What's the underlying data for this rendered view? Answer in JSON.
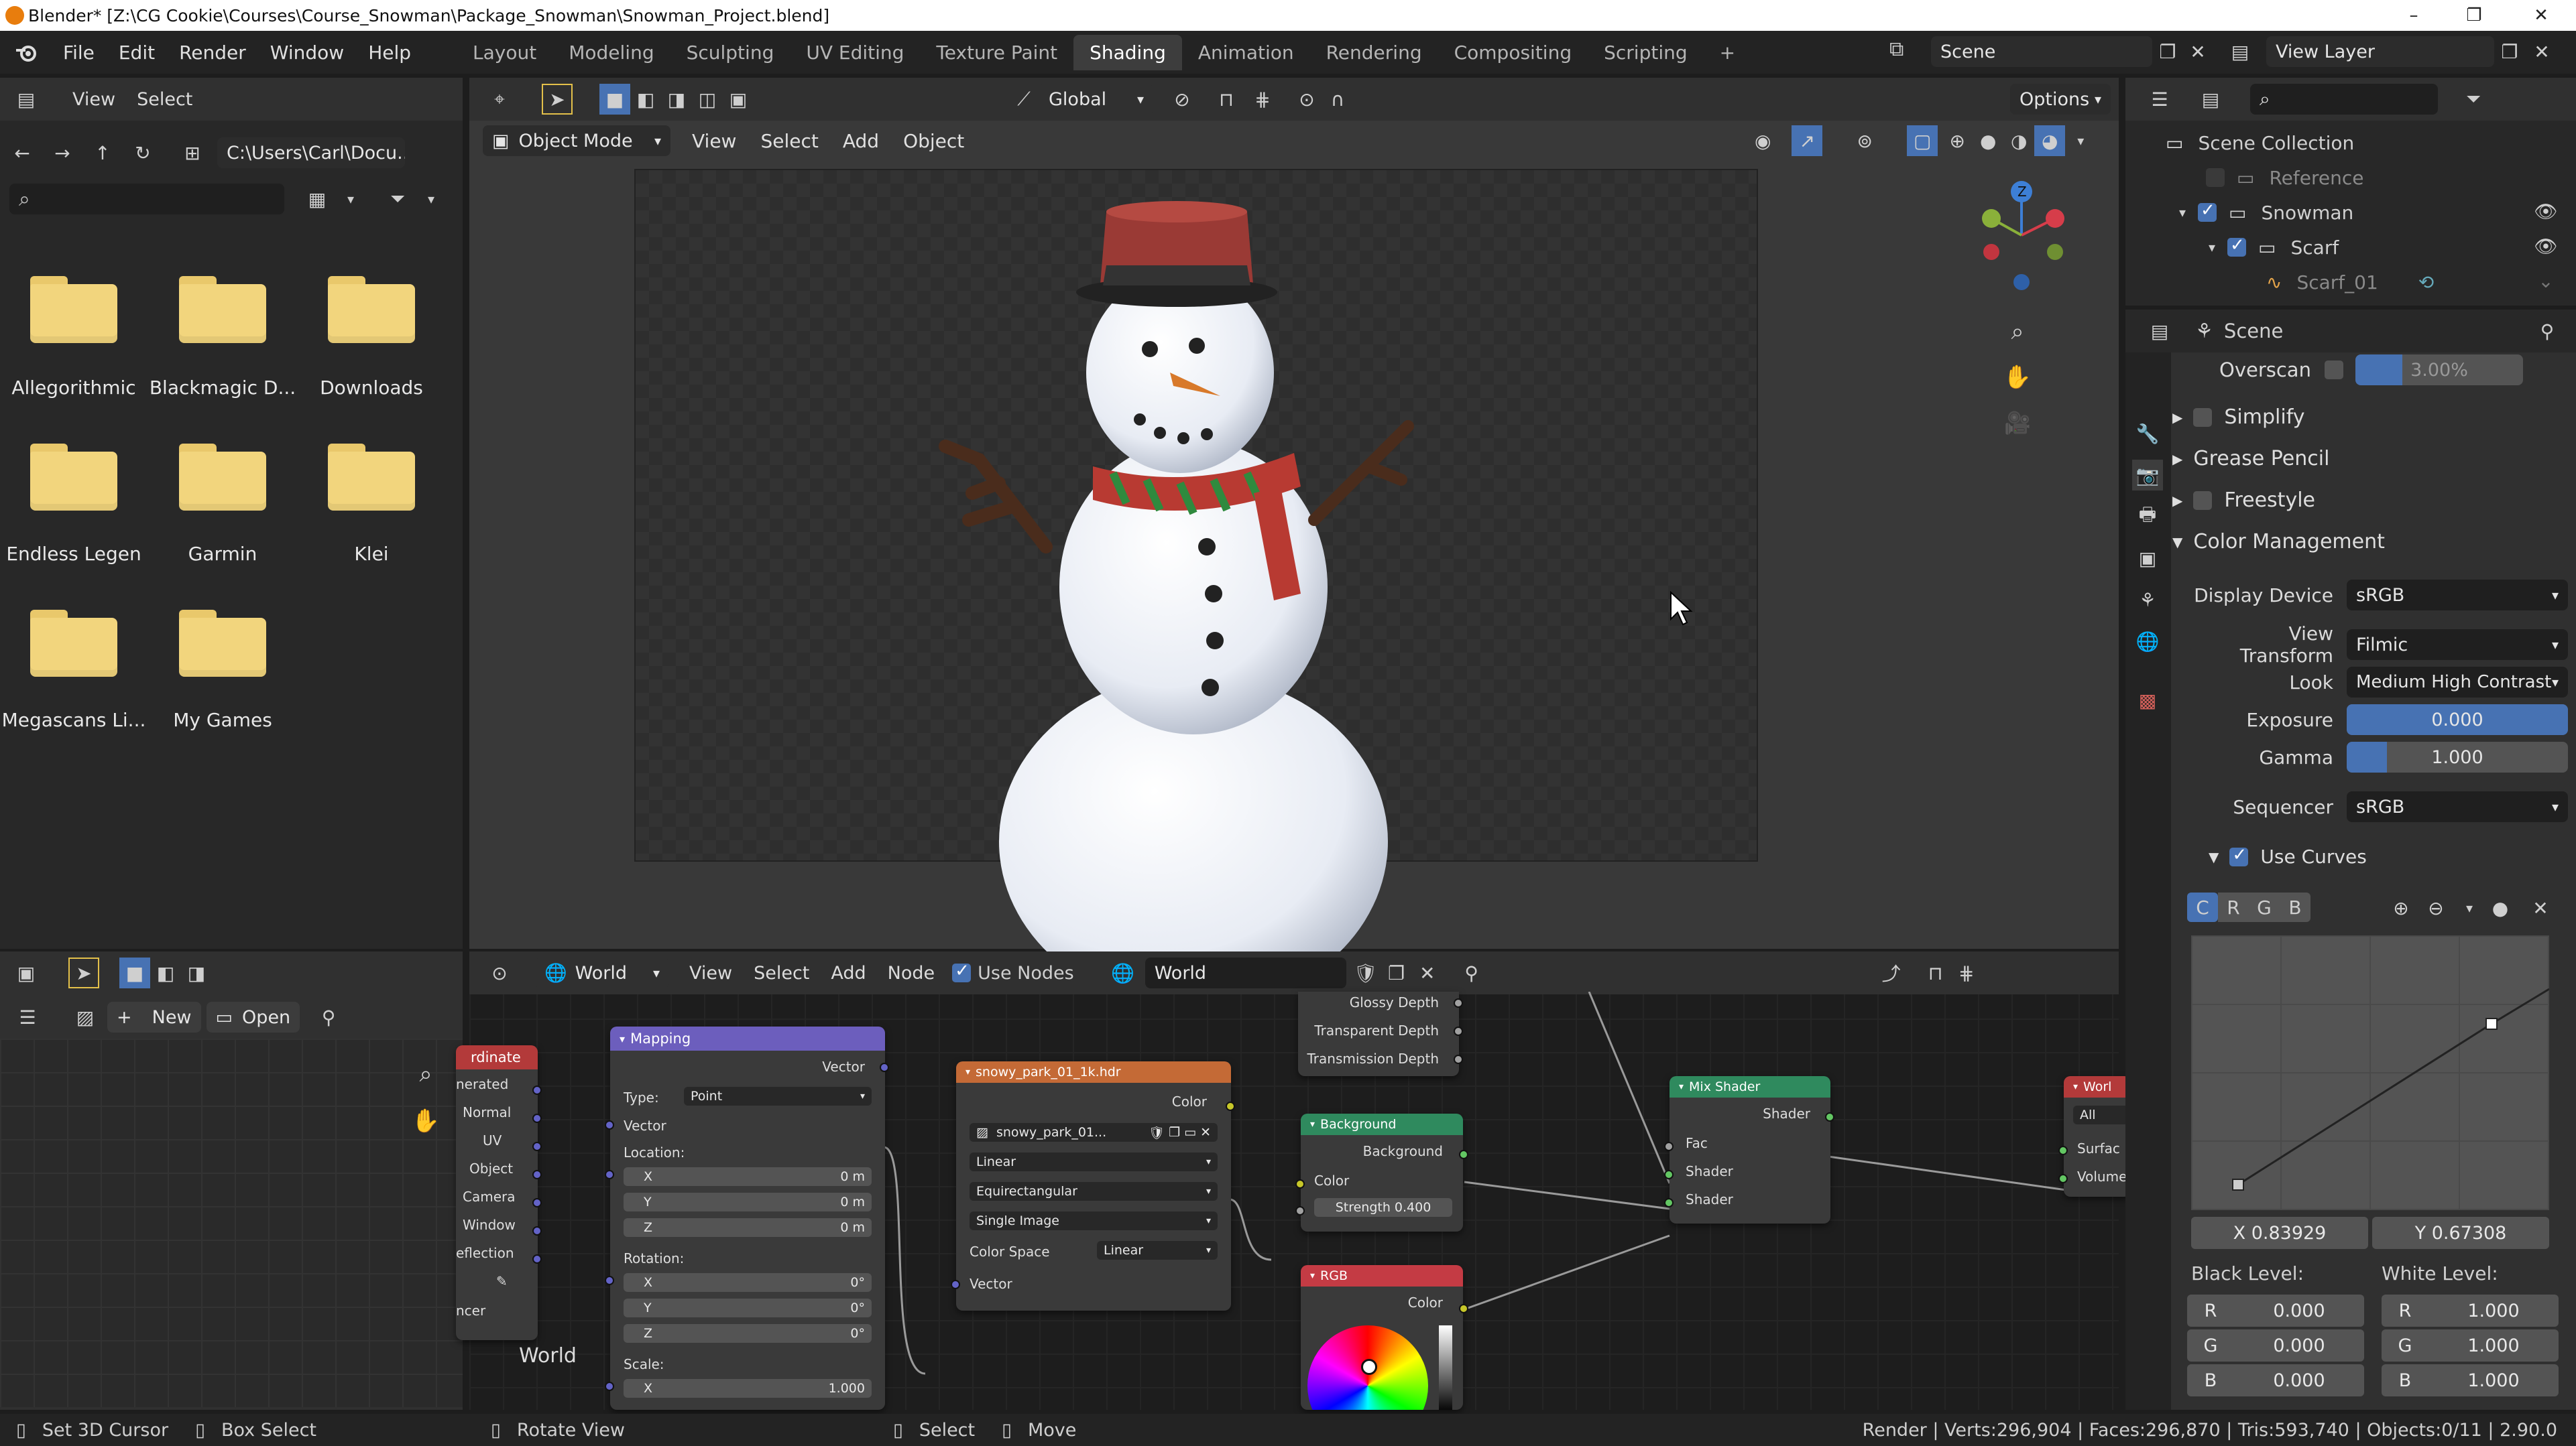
{
  "title_bar": {
    "title": "Blender* [Z:\\CG Cookie\\Courses\\Course_Snowman\\Package_Snowman\\Snowman_Project.blend]"
  },
  "menu": [
    "File",
    "Edit",
    "Render",
    "Window",
    "Help"
  ],
  "workspace_tabs": [
    "Layout",
    "Modeling",
    "Sculpting",
    "UV Editing",
    "Texture Paint",
    "Shading",
    "Animation",
    "Rendering",
    "Compositing",
    "Scripting"
  ],
  "active_tab": "Shading",
  "scene_selector": "Scene",
  "view_layer_selector": "View Layer",
  "file_browser": {
    "header": {
      "view": "View",
      "select": "Select"
    },
    "path": "C:\\Users\\Carl\\Docu...",
    "folders": [
      "Allegorithmic",
      "Blackmagic D...",
      "Downloads",
      "Endless Legen",
      "Garmin",
      "Klei",
      "Megascans Li...",
      "My Games"
    ]
  },
  "image_editor": {
    "new_label": "New",
    "open_label": "Open"
  },
  "viewport": {
    "transform_orientation": "Global",
    "options_label": "Options",
    "mode": "Object Mode",
    "menus": [
      "View",
      "Select",
      "Add",
      "Object"
    ]
  },
  "node_editor": {
    "world_type": "World",
    "menus": [
      "View",
      "Select",
      "Add",
      "Node"
    ],
    "use_nodes_label": "Use Nodes",
    "world_name": "World",
    "frame_label": "World",
    "texcoord": {
      "title": "rdinate",
      "outputs": [
        "nerated",
        "Normal",
        "UV",
        "Object",
        "Camera",
        "Window",
        "eflection"
      ],
      "footer": "ncer"
    },
    "mapping": {
      "title": "Mapping",
      "vector_out": "Vector",
      "type_label": "Type:",
      "type_value": "Point",
      "vector_in": "Vector",
      "location_label": "Location:",
      "loc": [
        {
          "axis": "X",
          "value": "0 m"
        },
        {
          "axis": "Y",
          "value": "0 m"
        },
        {
          "axis": "Z",
          "value": "0 m"
        }
      ],
      "rotation_label": "Rotation:",
      "rot": [
        {
          "axis": "X",
          "value": "0°"
        },
        {
          "axis": "Y",
          "value": "0°"
        },
        {
          "axis": "Z",
          "value": "0°"
        }
      ],
      "scale_label": "Scale:",
      "scale_x": {
        "axis": "X",
        "value": "1.000"
      }
    },
    "env_texture": {
      "title": "snowy_park_01_1k.hdr",
      "color_out": "Color",
      "image_name": "snowy_park_01...",
      "interpolation": "Linear",
      "projection": "Equirectangular",
      "source": "Single Image",
      "color_space_label": "Color Space",
      "color_space": "Linear",
      "vector_in": "Vector"
    },
    "light_path": {
      "outputs": [
        "Glossy Depth",
        "Transparent Depth",
        "Transmission Depth"
      ]
    },
    "background": {
      "title": "Background",
      "out": "Background",
      "color_in": "Color",
      "strength": "Strength  0.400"
    },
    "rgb": {
      "title": "RGB",
      "out": "Color"
    },
    "mix_shader": {
      "title": "Mix Shader",
      "out": "Shader",
      "inputs": [
        "Fac",
        "Shader",
        "Shader"
      ]
    },
    "world_output": {
      "title": "Worl",
      "target": "All",
      "inputs": [
        "Surfac",
        "Volume"
      ]
    }
  },
  "outliner": {
    "root": "Scene Collection",
    "items": [
      {
        "label": "Reference"
      },
      {
        "label": "Snowman"
      },
      {
        "label": "Scarf"
      },
      {
        "label": "Scarf_01"
      }
    ]
  },
  "properties": {
    "context": "Scene",
    "overscan_label": "Overscan",
    "overscan_value": "3.00%",
    "panels": [
      "Simplify",
      "Grease Pencil",
      "Freestyle",
      "Color Management"
    ],
    "display_device_label": "Display Device",
    "display_device": "sRGB",
    "view_transform_label": "View Transform",
    "view_transform": "Filmic",
    "look_label": "Look",
    "look": "Medium High Contrast",
    "exposure_label": "Exposure",
    "exposure": "0.000",
    "gamma_label": "Gamma",
    "gamma": "1.000",
    "sequencer_label": "Sequencer",
    "sequencer": "sRGB",
    "use_curves_label": "Use Curves",
    "curve_channels": [
      "C",
      "R",
      "G",
      "B"
    ],
    "curve_x": "X 0.83929",
    "curve_y": "Y 0.67308",
    "black_level_label": "Black Level:",
    "white_level_label": "White Level:",
    "black": [
      {
        "ch": "R",
        "v": "0.000"
      },
      {
        "ch": "G",
        "v": "0.000"
      },
      {
        "ch": "B",
        "v": "0.000"
      }
    ],
    "white": [
      {
        "ch": "R",
        "v": "1.000"
      },
      {
        "ch": "G",
        "v": "1.000"
      },
      {
        "ch": "B",
        "v": "1.000"
      }
    ]
  },
  "status_bar": {
    "set_cursor": "Set 3D Cursor",
    "box_select": "Box Select",
    "rotate_view": "Rotate View",
    "select": "Select",
    "move": "Move",
    "stats": "Render | Verts:296,904 | Faces:296,870 | Tris:593,740 | Objects:0/11 | 2.90.0"
  },
  "colors": {
    "accent": "#4772b3",
    "folder": "#f2d57d",
    "active_tab_bg": "#3d3d3d"
  }
}
